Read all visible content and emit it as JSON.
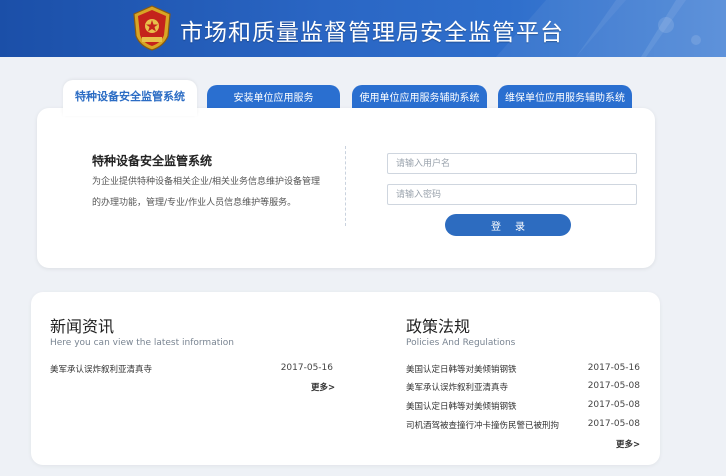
{
  "header": {
    "title": "市场和质量监督管理局安全监管平台",
    "emblem_icon": "national-emblem-icon"
  },
  "tabs": [
    {
      "label": "特种设备安全监管系统",
      "active": true
    },
    {
      "label": "安装单位应用服务",
      "active": false
    },
    {
      "label": "使用单位应用服务辅助系统",
      "active": false
    },
    {
      "label": "维保单位应用服务辅助系统",
      "active": false
    }
  ],
  "login": {
    "system_title": "特种设备安全监管系统",
    "description": "为企业提供特种设备相关企业/相关业务信息维护设备管理的办理功能，管理/专业/作业人员信息维护等服务。",
    "username_placeholder": "请输入用户名",
    "password_placeholder": "请输入密码",
    "submit_label": "登录"
  },
  "news": {
    "title": "新闻资讯",
    "subtitle": "Here you can view the latest information",
    "items": [
      {
        "text": "美军承认误炸叙利亚清真寺",
        "date": "2017-05-16"
      }
    ],
    "more_label": "更多>"
  },
  "policies": {
    "title": "政策法规",
    "subtitle": "Policies And Regulations",
    "items": [
      {
        "text": "美国认定日韩等对美倾销钢铁",
        "date": "2017-05-16"
      },
      {
        "text": "美军承认误炸叙利亚清真寺",
        "date": "2017-05-08"
      },
      {
        "text": "美国认定日韩等对美倾销钢铁",
        "date": "2017-05-08"
      },
      {
        "text": "司机酒驾被查撞行冲卡撞伤民警已被刑拘",
        "date": "2017-05-08"
      }
    ],
    "more_label": "更多>"
  },
  "colors": {
    "header_blue": "#2a66c4",
    "tab_blue": "#2a6fd0",
    "button_blue": "#2d6cc0",
    "page_background": "#eef1f6"
  }
}
